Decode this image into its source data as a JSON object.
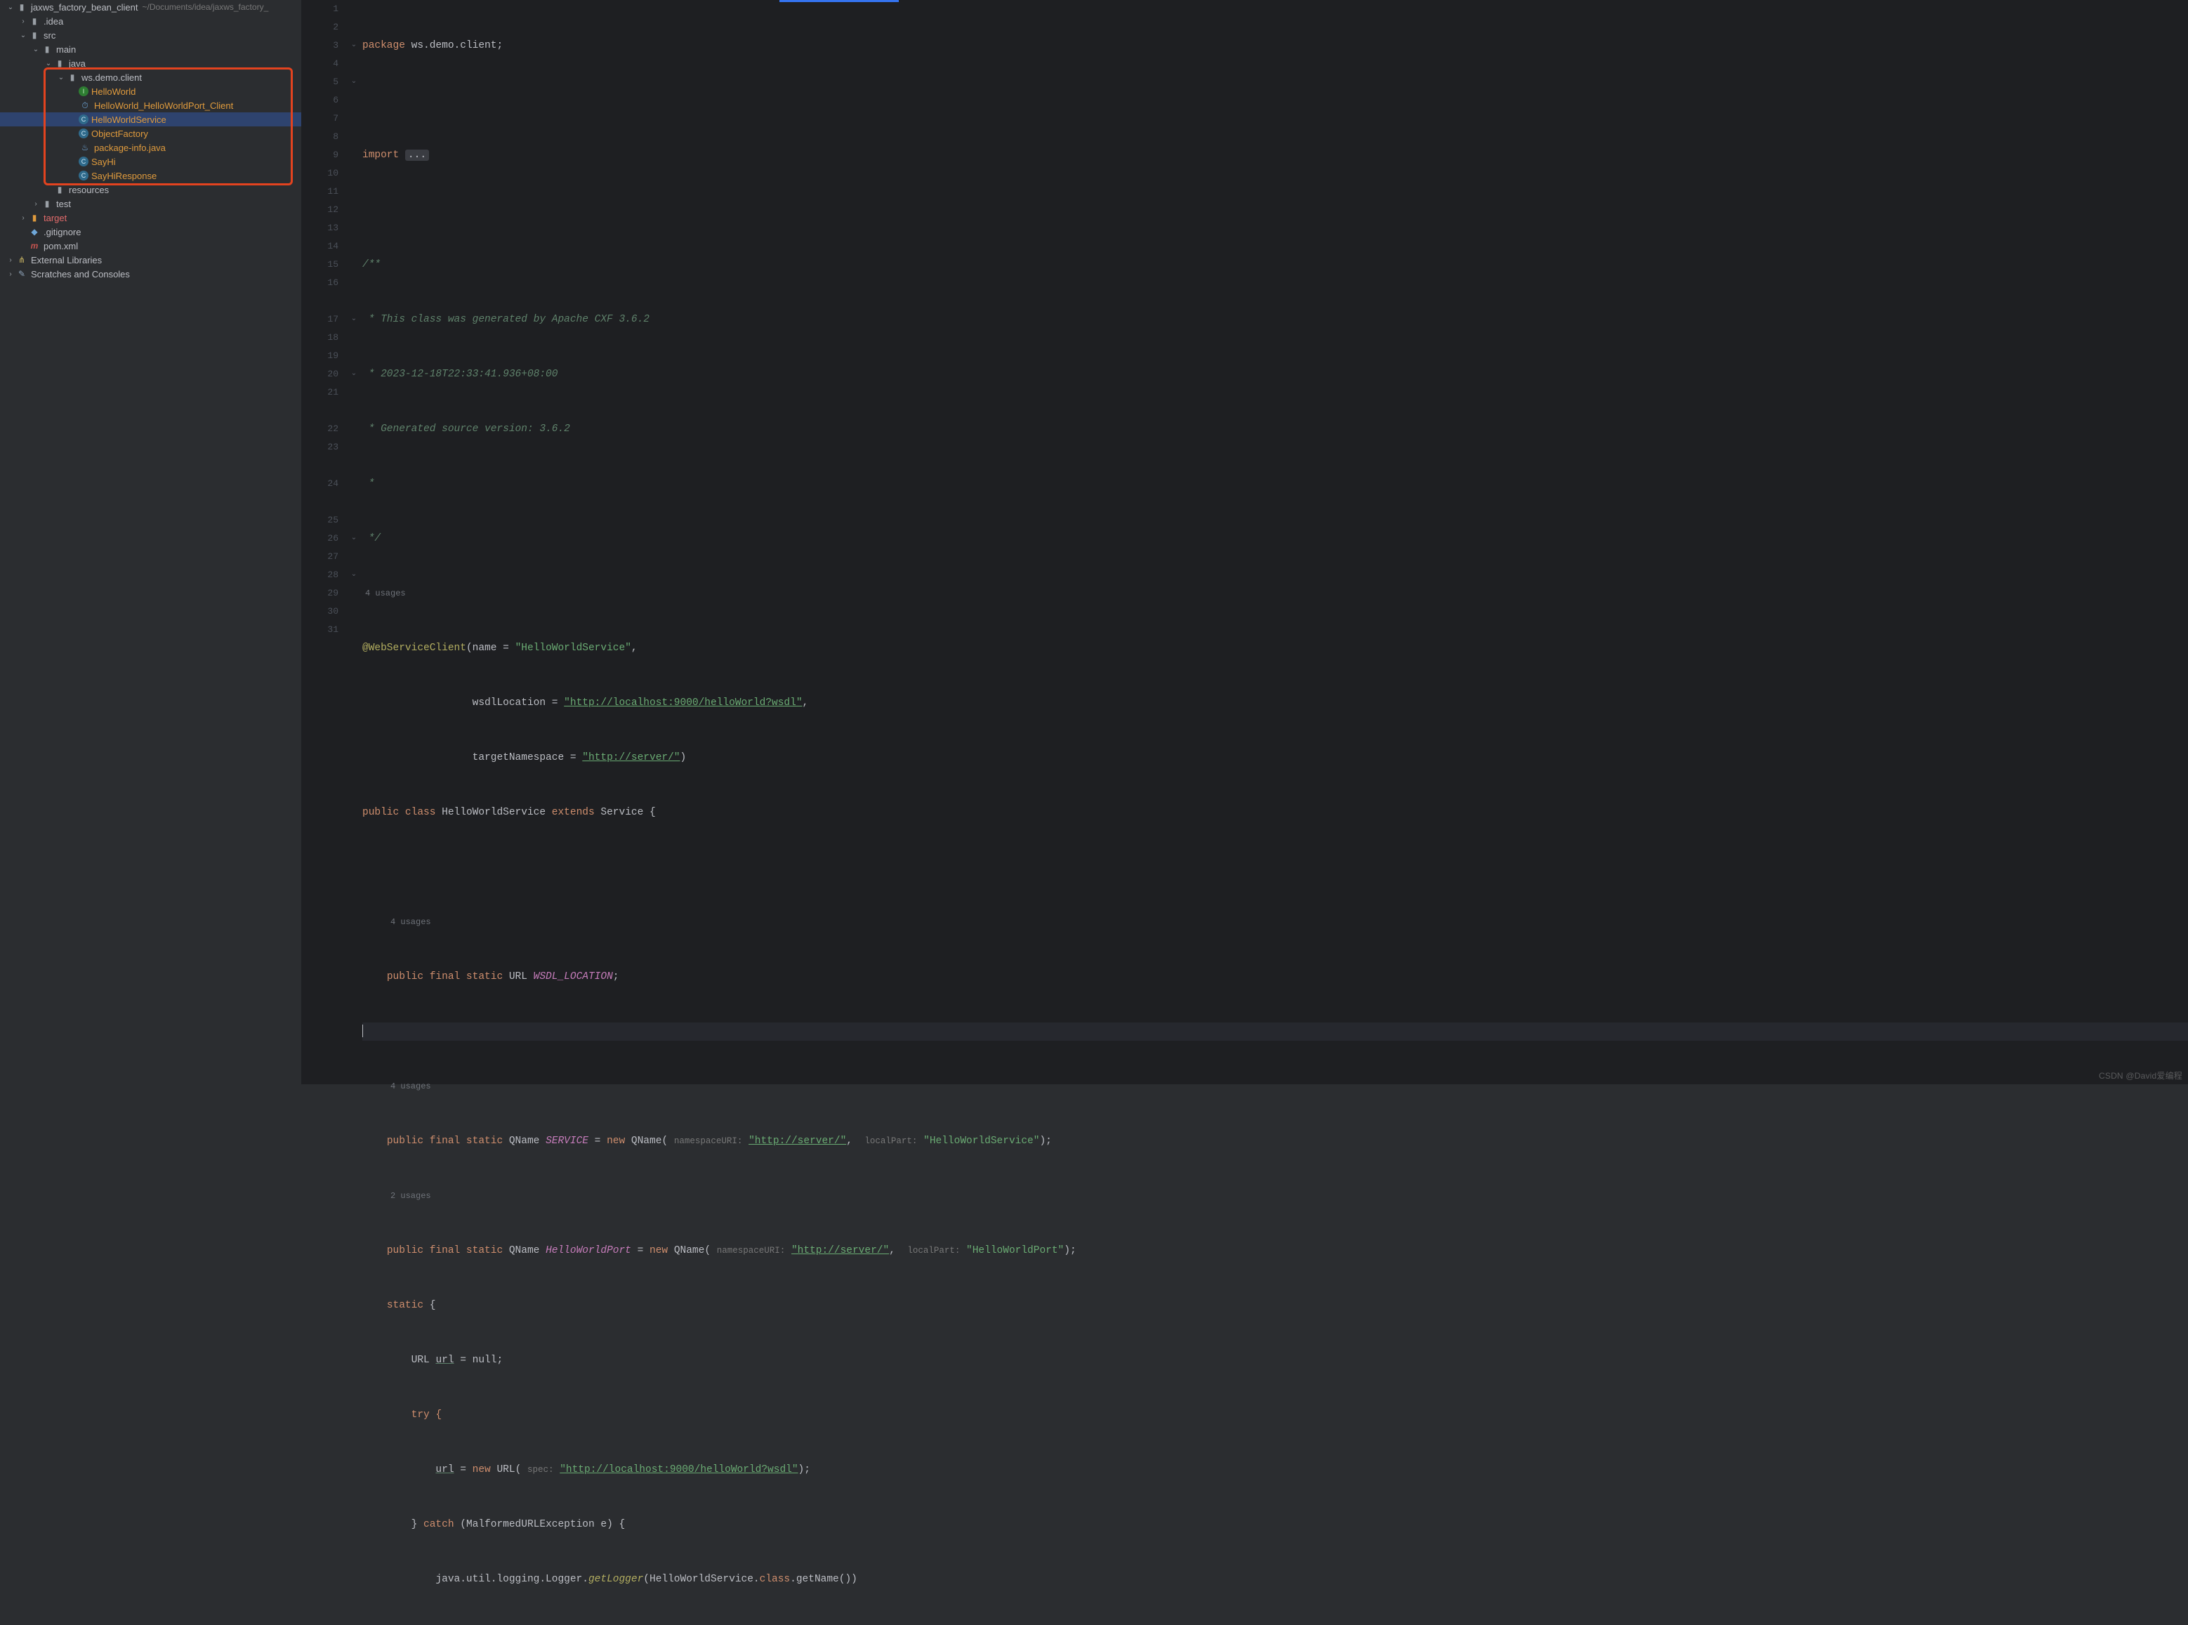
{
  "project": {
    "name": "jaxws_factory_bean_client",
    "path_hint": "~/Documents/idea/jaxws_factory_"
  },
  "tree": [
    {
      "indent": 0,
      "arrow": "▾",
      "icon": "folder",
      "label_bind": "project.name",
      "hint_bind": "project.path_hint"
    },
    {
      "indent": 1,
      "arrow": "▸",
      "icon": "folder",
      "label": ".idea"
    },
    {
      "indent": 1,
      "arrow": "▾",
      "icon": "folder",
      "label": "src"
    },
    {
      "indent": 2,
      "arrow": "▾",
      "icon": "folder",
      "label": "main"
    },
    {
      "indent": 3,
      "arrow": "▾",
      "icon": "folder",
      "label": "java"
    },
    {
      "indent": 4,
      "arrow": "▾",
      "icon": "folder",
      "label": "ws.demo.client",
      "boxstart": true
    },
    {
      "indent": 5,
      "arrow": "",
      "icon": "interface",
      "glyph": "I",
      "label": "HelloWorld",
      "color": "orange"
    },
    {
      "indent": 5,
      "arrow": "",
      "icon": "clock",
      "glyph": "⏱",
      "label": "HelloWorld_HelloWorldPort_Client",
      "color": "orange"
    },
    {
      "indent": 5,
      "arrow": "",
      "icon": "class-c",
      "glyph": "C",
      "label": "HelloWorldService",
      "color": "orange",
      "selected": true
    },
    {
      "indent": 5,
      "arrow": "",
      "icon": "class-c",
      "glyph": "C",
      "label": "ObjectFactory",
      "color": "orange"
    },
    {
      "indent": 5,
      "arrow": "",
      "icon": "jfile",
      "glyph": "♨",
      "label": "package-info.java",
      "color": "orange"
    },
    {
      "indent": 5,
      "arrow": "",
      "icon": "class-c",
      "glyph": "C",
      "label": "SayHi",
      "color": "orange"
    },
    {
      "indent": 5,
      "arrow": "",
      "icon": "class-c",
      "glyph": "C",
      "label": "SayHiResponse",
      "color": "orange",
      "boxend": true
    },
    {
      "indent": 3,
      "arrow": "",
      "icon": "folder",
      "label": "resources"
    },
    {
      "indent": 2,
      "arrow": "▸",
      "icon": "folder",
      "label": "test"
    },
    {
      "indent": 1,
      "arrow": "▸",
      "icon": "folder-orange",
      "label": "target",
      "color": "red"
    },
    {
      "indent": 1,
      "arrow": "",
      "icon": "jfile",
      "glyph": "◆",
      "label": ".gitignore"
    },
    {
      "indent": 1,
      "arrow": "",
      "icon": "maven",
      "glyph": "m",
      "label": "pom.xml"
    },
    {
      "indent": 0,
      "arrow": "▸",
      "icon": "lib",
      "glyph": "⋔",
      "label": "External Libraries"
    },
    {
      "indent": 0,
      "arrow": "▸",
      "icon": "scratch",
      "glyph": "✎",
      "label": "Scratches and Consoles"
    }
  ],
  "code": {
    "package_kw": "package",
    "package_name": "ws.demo.client",
    "import_kw": "import",
    "ellipsis": "...",
    "javadoc": {
      "l1": "/**",
      "l2": " * This class was generated by Apache CXF 3.6.2",
      "l3": " * 2023-12-18T22:33:41.936+08:00",
      "l4": " * Generated source version: 3.6.2",
      "l5": " *",
      "l6": " */"
    },
    "usages4": "4 usages",
    "usages2": "2 usages",
    "ann": "@WebServiceClient",
    "ann_args": {
      "name_k": "name = ",
      "name_v": "\"HelloWorldService\"",
      "wsdl_k": "wsdlLocation = ",
      "wsdl_v": "\"http://localhost:9000/helloWorld?wsdl\"",
      "tns_k": "targetNamespace = ",
      "tns_v": "\"http://server/\""
    },
    "classline": {
      "public": "public",
      "class": "class",
      "name": "HelloWorldService",
      "extends": "extends",
      "super": "Service",
      "brace": "{"
    },
    "wsdlloc": {
      "mods": "public final static",
      "type": "URL",
      "name": "WSDL_LOCATION",
      "end": ";"
    },
    "servicef": {
      "mods": "public final static",
      "type": "QName",
      "field": "SERVICE",
      "eq": " = ",
      "new": "new",
      "ctor": "QName",
      "hint1": "namespaceURI:",
      "arg1": "\"http://server/\"",
      "hint2": "localPart:",
      "arg2": "\"HelloWorldService\"",
      "end": ");"
    },
    "portf": {
      "mods": "public final static",
      "type": "QName",
      "field": "HelloWorldPort",
      "eq": " = ",
      "new": "new",
      "ctor": "QName",
      "hint1": "namespaceURI:",
      "arg1": "\"http://server/\"",
      "hint2": "localPart:",
      "arg2": "\"HelloWorldPort\"",
      "end": ");"
    },
    "staticblk": {
      "kw": "static",
      "brace": "{"
    },
    "urlnull": {
      "type": "URL",
      "var": "url",
      "rest": " = null;"
    },
    "try": "try {",
    "urlassign": {
      "var": "url",
      "eq": " = ",
      "new": "new",
      "ctor": "URL",
      "hint": "spec:",
      "arg": "\"http://localhost:9000/helloWorld?wsdl\"",
      "end": ");"
    },
    "catch": {
      "close": "}",
      "kw": "catch",
      "rest": " (MalformedURLException e) {"
    },
    "logger": {
      "prefix": "java.util.logging.Logger.",
      "call": "getLogger",
      "rest": "(HelloWorldService.",
      "class_kw": "class",
      "rest2": ".getName())"
    }
  },
  "linenums": [
    "1",
    "2",
    "3",
    "4",
    "5",
    "6",
    "7",
    "8",
    "9",
    "10",
    "11",
    "12",
    "13",
    "14",
    "15",
    "16",
    "",
    "17",
    "18",
    "19",
    "20",
    "21",
    "",
    "22",
    "23",
    "",
    "24",
    "",
    "25",
    "26",
    "27",
    "28",
    "29",
    "30",
    "31"
  ],
  "watermark": "CSDN @David爱编程"
}
